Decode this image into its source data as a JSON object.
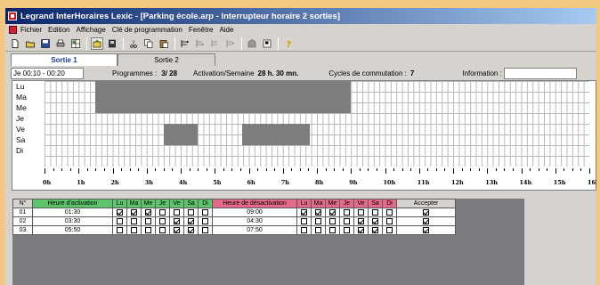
{
  "window": {
    "title": "Legrand InterHoraires Lexic  - [Parking école.arp  - Interrupteur horaire 2 sorties]"
  },
  "menu": [
    "Fichier",
    "Edition",
    "Affichage",
    "Clé de programmation",
    "Fenêtre",
    "Aide"
  ],
  "toolbar": [
    "new-icon",
    "open-icon",
    "save-icon",
    "print-icon",
    "grid-icon",
    "upload-icon",
    "download-icon",
    "cut-icon",
    "copy-icon",
    "paste-icon",
    "insert-row-icon",
    "delete-row-icon",
    "move-row-icon",
    "move-row-2-icon",
    "import-icon",
    "flag-icon",
    "help-icon"
  ],
  "tabs": [
    "Sortie 1",
    "Sortie 2"
  ],
  "info": {
    "slot": "Je 00:10 - 00:20",
    "programmes_label": "Programmes :",
    "programmes_value": "3/ 28",
    "activation_label": "Activation/Semaine",
    "activation_value": "28 h. 30 mn.",
    "cycles_label": "Cycles de commutation :",
    "cycles_value": "7",
    "information_label": "Information :",
    "information_value": ""
  },
  "schedule": {
    "days": [
      "Lu",
      "Ma",
      "Me",
      "Je",
      "Ve",
      "Sa",
      "Di"
    ],
    "hours": [
      "0h",
      "1h",
      "2h",
      "3h",
      "4h",
      "5h",
      "6h",
      "7h",
      "8h",
      "9h",
      "10h",
      "11h",
      "12h",
      "13h",
      "14h",
      "15h",
      "16h"
    ],
    "active_color": "#7d7d7d"
  },
  "table": {
    "headers": [
      "N°",
      "Heure d'activation",
      "Lu",
      "Ma",
      "Me",
      "Je",
      "Ve",
      "Sa",
      "Di",
      "Heure de désactivation",
      "Lu",
      "Ma",
      "Me",
      "Je",
      "Ve",
      "Sa",
      "Di",
      "Accepter"
    ],
    "rows": [
      {
        "n": "01",
        "on": "01:30",
        "on_days": [
          1,
          1,
          1,
          0,
          0,
          0,
          0
        ],
        "off": "09:00",
        "off_days": [
          1,
          1,
          1,
          0,
          0,
          0,
          0
        ],
        "accept": 1
      },
      {
        "n": "02",
        "on": "03:30",
        "on_days": [
          0,
          0,
          0,
          0,
          1,
          1,
          0
        ],
        "off": "04:30",
        "off_days": [
          0,
          0,
          0,
          0,
          1,
          1,
          0
        ],
        "accept": 1
      },
      {
        "n": "03",
        "on": "05:50",
        "on_days": [
          0,
          0,
          0,
          0,
          1,
          1,
          0
        ],
        "off": "07:50",
        "off_days": [
          0,
          0,
          0,
          0,
          1,
          1,
          0
        ],
        "accept": 1
      }
    ]
  }
}
